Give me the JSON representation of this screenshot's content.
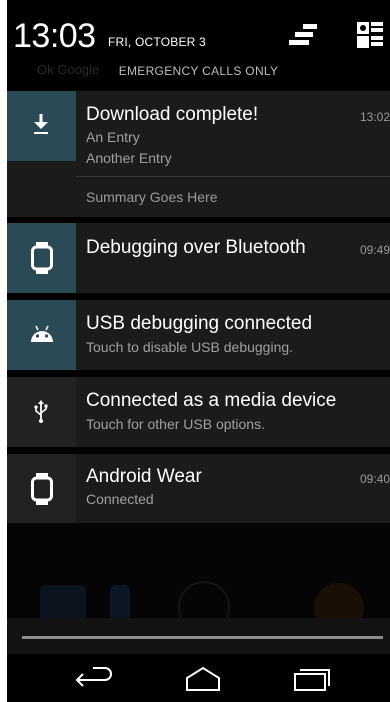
{
  "status": {
    "time": "13:03",
    "date": "FRI, OCTOBER 3",
    "emergency": "EMERGENCY CALLS ONLY",
    "background_ghost_text": "Ok Google"
  },
  "notifications": [
    {
      "icon": "download-icon",
      "title": "Download complete!",
      "lines": [
        "An Entry",
        "Another Entry"
      ],
      "summary": "Summary Goes Here",
      "time": "13:02"
    },
    {
      "icon": "watch-icon",
      "title": "Debugging over Bluetooth",
      "time": "09:49"
    },
    {
      "icon": "android-icon",
      "title": "USB debugging connected",
      "subtitle": "Touch to disable USB debugging."
    },
    {
      "icon": "usb-icon",
      "title": "Connected as a media device",
      "subtitle": "Touch for other USB options."
    },
    {
      "icon": "watch-icon",
      "title": "Android Wear",
      "subtitle": "Connected",
      "time": "09:40"
    }
  ],
  "navbar": {
    "back": "back-icon",
    "home": "home-icon",
    "recents": "recents-icon"
  },
  "colors": {
    "accent_tile": "#2a4a55",
    "card": "#1b1b1b"
  }
}
